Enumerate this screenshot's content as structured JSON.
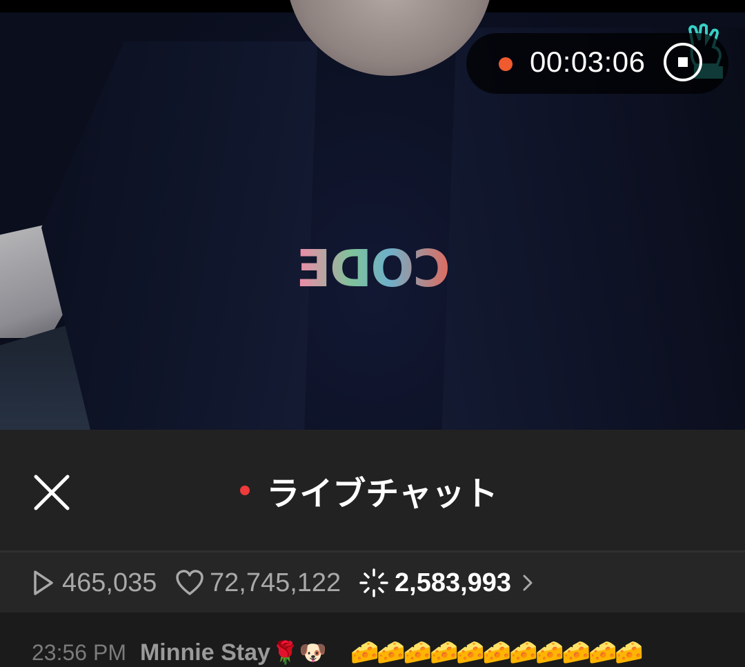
{
  "recording": {
    "timer": "00:03:06"
  },
  "chat": {
    "title": "ライブチャット"
  },
  "stats": {
    "plays": "465,035",
    "likes": "72,745,122",
    "sparkles": "2,583,993"
  },
  "messages": [
    {
      "time": "23:56 PM",
      "user": "Minnie Stay",
      "user_emoji": "🌹🐶",
      "text": "🧀🧀🧀🧀🧀🧀🧀🧀🧀🧀🧀"
    }
  ],
  "shirt_print": "CODE",
  "colors": {
    "record_dot": "#ef5a2f",
    "live_dot": "#ee3a3a",
    "panel_bg": "#222222"
  },
  "icons": [
    "close-icon",
    "play-icon",
    "heart-icon",
    "sparkle-icon",
    "chevron-right-icon",
    "stop-icon",
    "vlive-badge-icon"
  ]
}
